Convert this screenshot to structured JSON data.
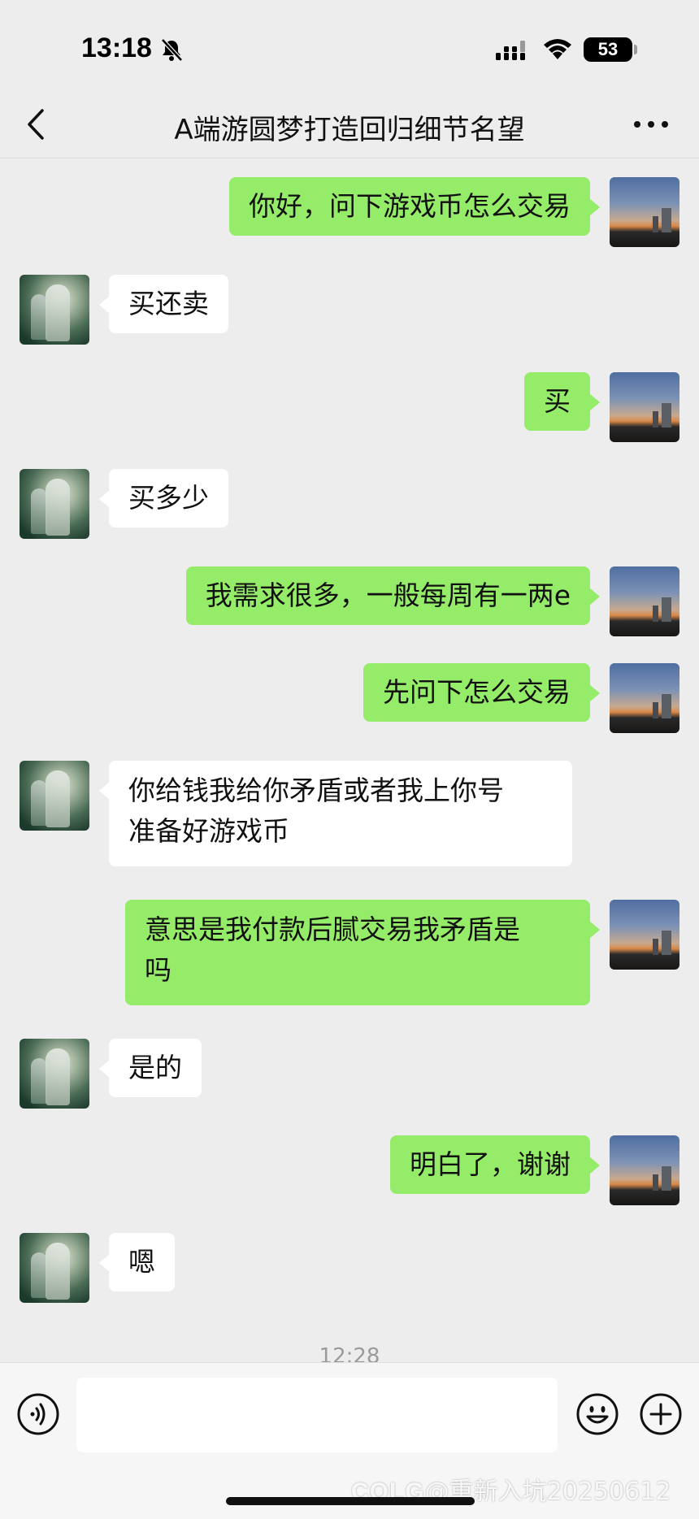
{
  "status_bar": {
    "time": "13:18",
    "battery": "53"
  },
  "header": {
    "title": "A端游圆梦打造回归细节名望"
  },
  "messages": [
    {
      "from": "self",
      "text": "你好，问下游戏币怎么交易"
    },
    {
      "from": "other",
      "text": "买还卖"
    },
    {
      "from": "self",
      "text": "买"
    },
    {
      "from": "other",
      "text": "买多少"
    },
    {
      "from": "self",
      "text": "我需求很多，一般每周有一两e"
    },
    {
      "from": "self",
      "text": "先问下怎么交易"
    },
    {
      "from": "other",
      "text": "你给钱我给你矛盾或者我上你号\n准备好游戏币"
    },
    {
      "from": "self",
      "text": "意思是我付款后腻交易我矛盾是\n吗"
    },
    {
      "from": "other",
      "text": "是的"
    },
    {
      "from": "self",
      "text": "明白了，谢谢"
    },
    {
      "from": "other",
      "text": "嗯"
    }
  ],
  "timestamp": "12:28",
  "input": {
    "placeholder": ""
  },
  "icons": {
    "back": "chevron-left-icon",
    "more": "more-dots-icon",
    "voice": "voice-icon",
    "emoji": "emoji-icon",
    "plus": "plus-icon",
    "mute": "bell-slash-icon"
  },
  "colors": {
    "self_bubble": "#95ec69",
    "other_bubble": "#ffffff",
    "background": "#ededed"
  },
  "watermark": {
    "logo": "COLG",
    "text": "@重新入坑20250612"
  }
}
